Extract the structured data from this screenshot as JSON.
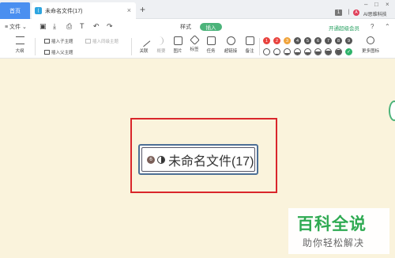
{
  "titlebar": {
    "home_tab": "首页",
    "doc_tab": "未命名文件(17)",
    "badge": "1",
    "user_avatar": "A",
    "user_name": "AI思维科技"
  },
  "menu": {
    "file_label": "文件",
    "tabs": [
      "样式",
      "插入"
    ],
    "active_tab": "插入",
    "vip_link": "开通超级会员",
    "help": "?"
  },
  "ribbon": {
    "outline_label": "大纲",
    "insert_child": "插入子主题",
    "insert_sibling": "插入同级主题",
    "insert_parent": "插入父主题",
    "items": [
      "关联",
      "概要",
      "图片",
      "标签",
      "任务",
      "超链接",
      "备注"
    ],
    "number_badges": [
      "1",
      "2",
      "3",
      "4",
      "5",
      "6",
      "7",
      "8",
      "9"
    ],
    "number_colors": [
      "#e8413c",
      "#e8413c",
      "#f0a33a",
      "#555555",
      "#555555",
      "#555555",
      "#555555",
      "#555555",
      "#555555"
    ],
    "progress_levels": [
      0,
      0.125,
      0.25,
      0.375,
      0.5,
      0.625,
      0.75,
      0.875,
      1
    ],
    "more_icons": "更多图标"
  },
  "canvas": {
    "root_badge": "6",
    "root_progress": 0.5,
    "root_title": "未命名文件(17)"
  },
  "watermark": {
    "title": "百科全说",
    "subtitle": "助你轻松解决"
  },
  "colors": {
    "accent_green": "#4bb37a",
    "highlight_red": "#d9262b",
    "home_blue": "#4a8ff0"
  }
}
